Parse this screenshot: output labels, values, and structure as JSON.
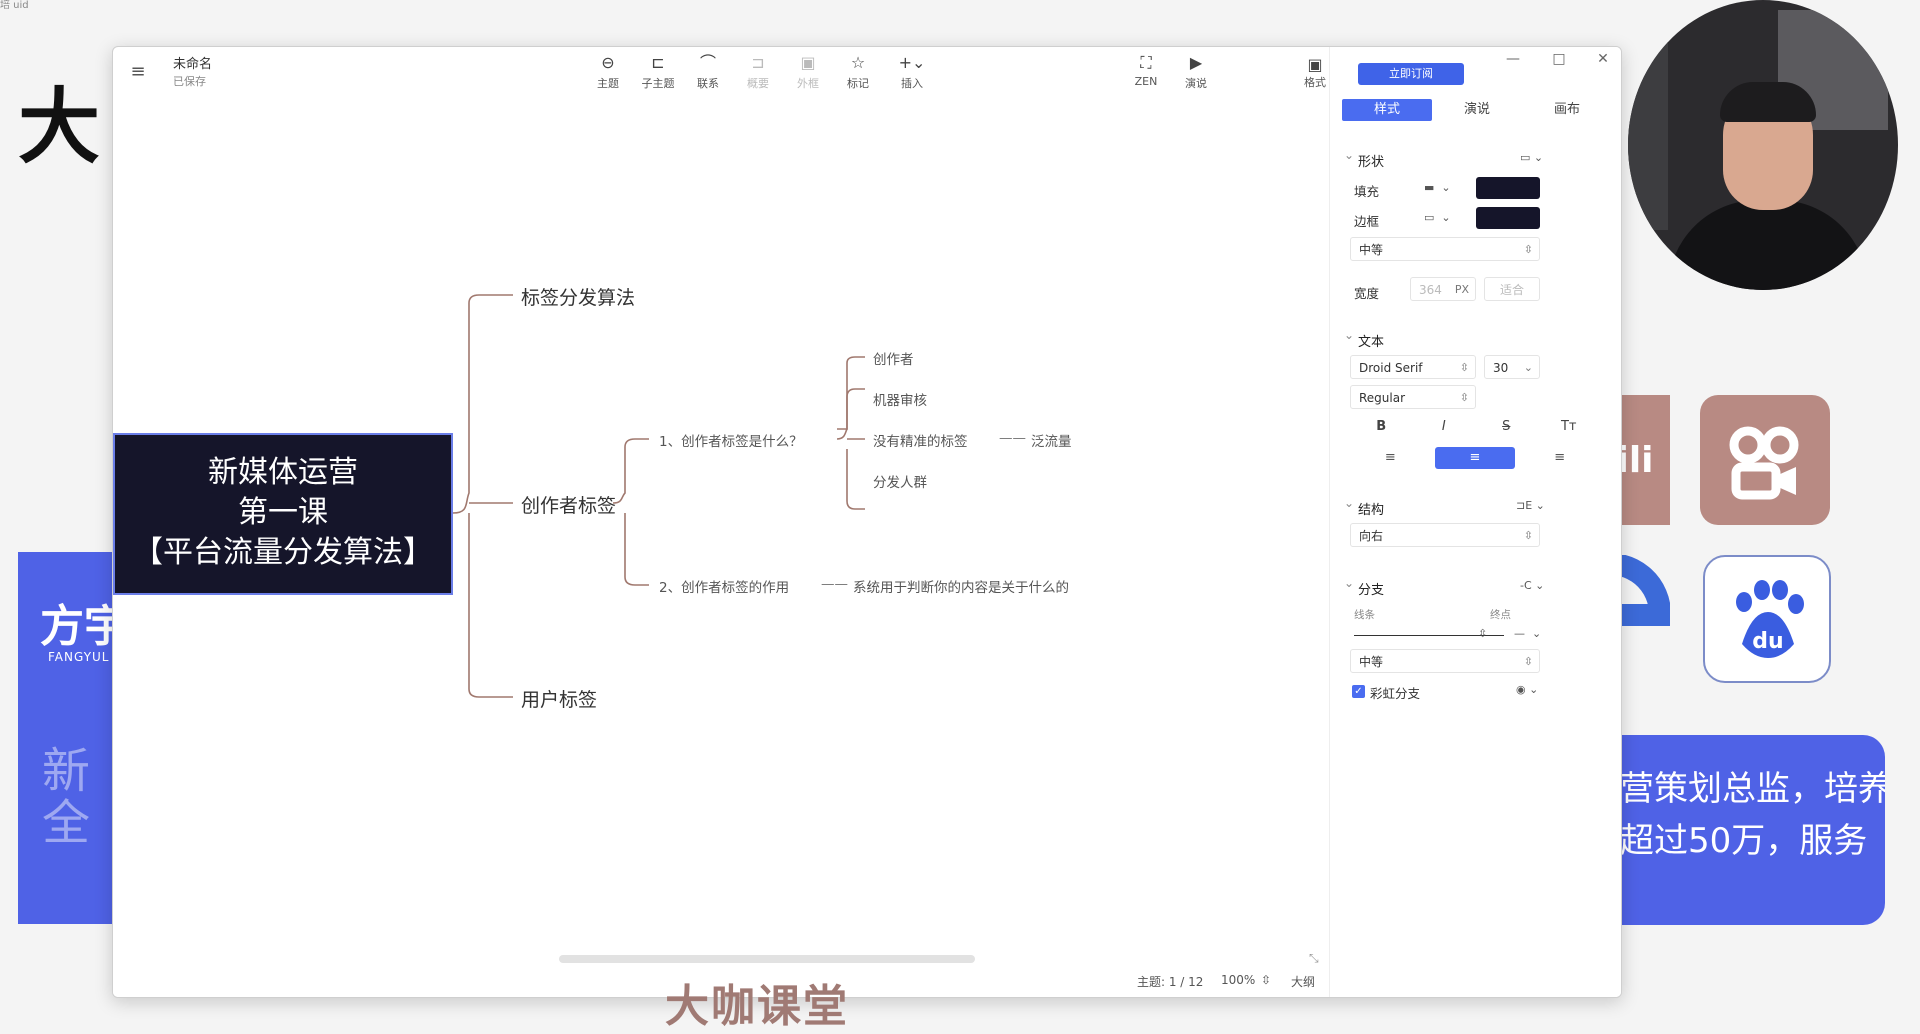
{
  "background": {
    "big_char": "大",
    "left_name": "方宇",
    "left_sub": "FANGYUL",
    "left_faint": "新全",
    "bili_text": "ili",
    "info_lines": [
      "营策划总监，培养",
      "超过50万，服务"
    ],
    "watermark": "大咖课堂"
  },
  "corner_tag": "培\nuid",
  "app": {
    "doc_title": "未命名",
    "doc_status": "已保存",
    "tools": [
      {
        "label": "主题",
        "icon": "topic-icon",
        "glyph": "⊖",
        "enabled": true
      },
      {
        "label": "子主题",
        "icon": "subtopic-icon",
        "glyph": "⊏",
        "enabled": true
      },
      {
        "label": "联系",
        "icon": "relationship-icon",
        "glyph": "⌒",
        "enabled": true
      },
      {
        "label": "概要",
        "icon": "summary-icon",
        "glyph": "⊐",
        "enabled": false
      },
      {
        "label": "外框",
        "icon": "boundary-icon",
        "glyph": "▣",
        "enabled": false
      },
      {
        "label": "标记",
        "icon": "marker-icon",
        "glyph": "☆",
        "enabled": true
      },
      {
        "label": "插入",
        "icon": "insert-icon",
        "glyph": "+⌄",
        "enabled": true
      },
      {
        "label": "ZEN",
        "icon": "zen-icon",
        "glyph": "⛶",
        "enabled": true
      },
      {
        "label": "演说",
        "icon": "present-icon",
        "glyph": "▶",
        "enabled": true
      }
    ],
    "format_label": "格式",
    "subscribe_label": "立即订阅",
    "window_controls": [
      "—",
      "□",
      "✕"
    ]
  },
  "mindmap": {
    "root": [
      "新媒体运营",
      "第一课",
      "【平台流量分发算法】"
    ],
    "branches": [
      "标签分发算法",
      "创作者标签",
      "用户标签"
    ],
    "sub": [
      "1、创作者标签是什么？",
      "2、创作者标签的作用"
    ],
    "leaves": [
      "创作者",
      "机器审核",
      "没有精准的标签",
      "分发人群"
    ],
    "leaf_tail": "泛流量",
    "effect_text": "系统用于判断你的内容是关于什么的",
    "connector": "——"
  },
  "status": {
    "topics": "主题: 1 / 12",
    "zoom": "100%",
    "outline": "大纲"
  },
  "panel": {
    "tabs": [
      "样式",
      "演说",
      "画布"
    ],
    "shape_section": "形状",
    "fill_label": "填充",
    "border_label": "边框",
    "border_weight": "中等",
    "width_label": "宽度",
    "width_value": "364",
    "width_unit": "PX",
    "fit_label": "适合",
    "text_section": "文本",
    "font_family": "Droid Serif",
    "font_size": "30",
    "font_weight": "Regular",
    "text_styles": [
      "B",
      "I",
      "S",
      "Tт"
    ],
    "align": [
      "≡",
      "≡",
      "≡"
    ],
    "structure_section": "结构",
    "structure_value": "向右",
    "branch_section": "分支",
    "line_label": "线条",
    "end_label": "终点",
    "branch_weight": "中等",
    "rainbow_label": "彩虹分支",
    "colors": {
      "accent": "#4a6cf0",
      "node_fill": "#15152a",
      "branch_line": "#a0786e"
    }
  }
}
